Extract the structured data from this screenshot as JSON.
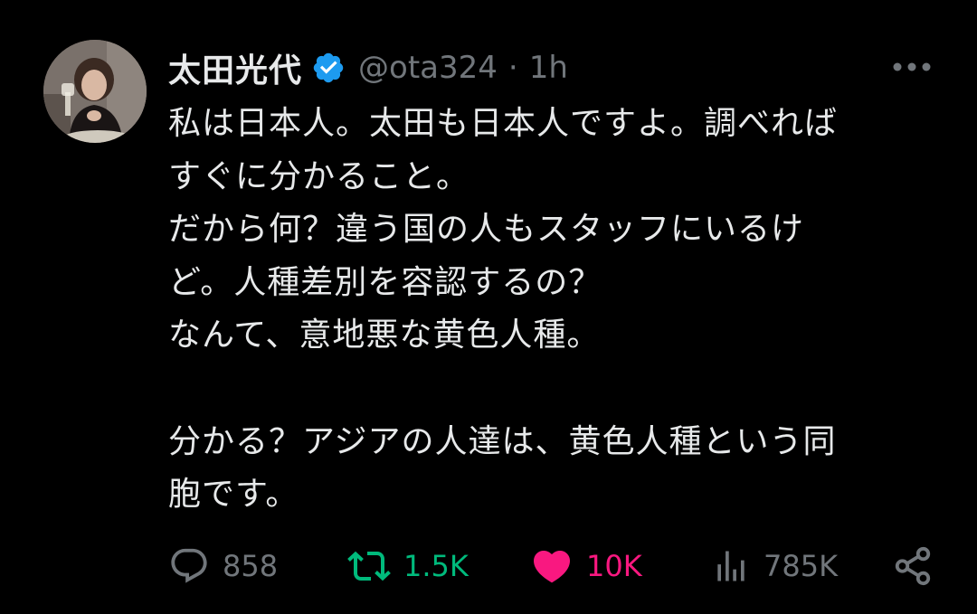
{
  "author": {
    "display_name": "太田光代",
    "handle": "@ota324",
    "separator": "·",
    "time": "1h",
    "verified": true
  },
  "tweet": {
    "paragraphs": [
      "私は日本人。太田も日本人ですよ。調べれば\nすぐに分かること。\nだから何？違う国の人もスタッフにいるけ\nど。人種差別を容認するの？\nなんて、意地悪な黄色人種。",
      "分かる？アジアの人達は、黄色人種という同\n胞です。"
    ]
  },
  "actions": {
    "replies": "858",
    "retweets": "1.5K",
    "likes": "10K",
    "views": "785K"
  },
  "colors": {
    "background": "#000000",
    "text": "#e7e9ea",
    "muted": "#71767b",
    "verified_blue": "#1d9bf0",
    "retweet_green": "#00ba7c",
    "like_pink": "#f91880"
  },
  "icons": {
    "verified": "verified-badge-icon",
    "more": "more-dots-icon",
    "reply": "reply-bubble-icon",
    "retweet": "retweet-arrows-icon",
    "like": "heart-icon",
    "views": "views-bars-icon",
    "share": "share-icon"
  }
}
